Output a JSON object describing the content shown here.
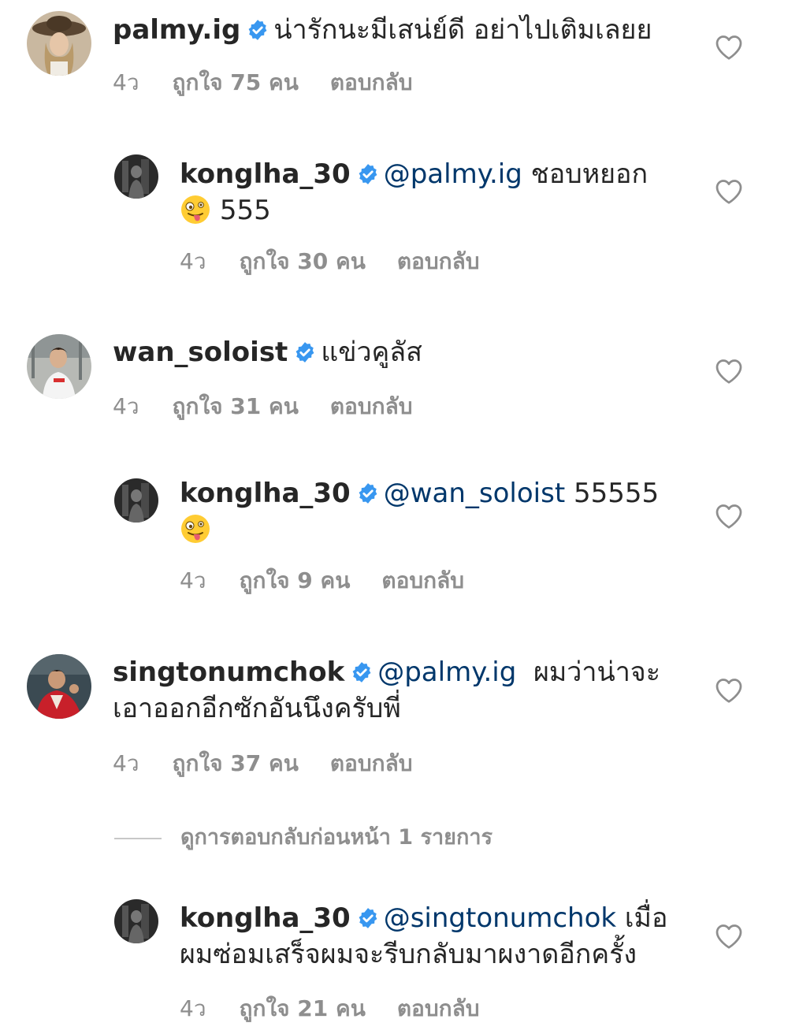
{
  "comments": [
    {
      "username": "palmy.ig",
      "text": "น่ารักนะมีเสน่ย์ดี อย่าไปเติมเลยย",
      "time": "4ว",
      "likes": "ถูกใจ 75 คน",
      "reply": "ตอบกลับ"
    },
    {
      "username": "konglha_30",
      "mention": "@palmy.ig",
      "text": "ชอบหยอก",
      "text2": "555",
      "time": "4ว",
      "likes": "ถูกใจ 30 คน",
      "reply": "ตอบกลับ"
    },
    {
      "username": "wan_soloist",
      "text": "แข่วคูลัส",
      "time": "4ว",
      "likes": "ถูกใจ 31 คน",
      "reply": "ตอบกลับ"
    },
    {
      "username": "konglha_30",
      "mention": "@wan_soloist",
      "text": "55555",
      "time": "4ว",
      "likes": "ถูกใจ 9 คน",
      "reply": "ตอบกลับ"
    },
    {
      "username": "singtonumchok",
      "mention": "@palmy.ig",
      "text": "ผมว่าน่าจะ",
      "text2": "เอาออกอีกซักอันนึงครับพี่",
      "time": "4ว",
      "likes": "ถูกใจ 37 คน",
      "reply": "ตอบกลับ"
    },
    {
      "username": "konglha_30",
      "mention": "@singtonumchok",
      "text": "เมื่อ",
      "text2": "ผมซ่อมเสร็จผมจะรีบกลับมาผงาดอีกครั้ง",
      "time": "4ว",
      "likes": "ถูกใจ 21 คน",
      "reply": "ตอบกลับ"
    }
  ],
  "view_previous_replies": "ดูการตอบกลับก่อนหน้า 1 รายการ",
  "icons": {
    "verified": "verified-badge-icon",
    "heart": "heart-outline-icon",
    "emoji": "zany-face-emoji"
  },
  "colors": {
    "text": "#262626",
    "secondary": "#8e8e8e",
    "mention": "#00376b",
    "verified": "#3897f0"
  }
}
